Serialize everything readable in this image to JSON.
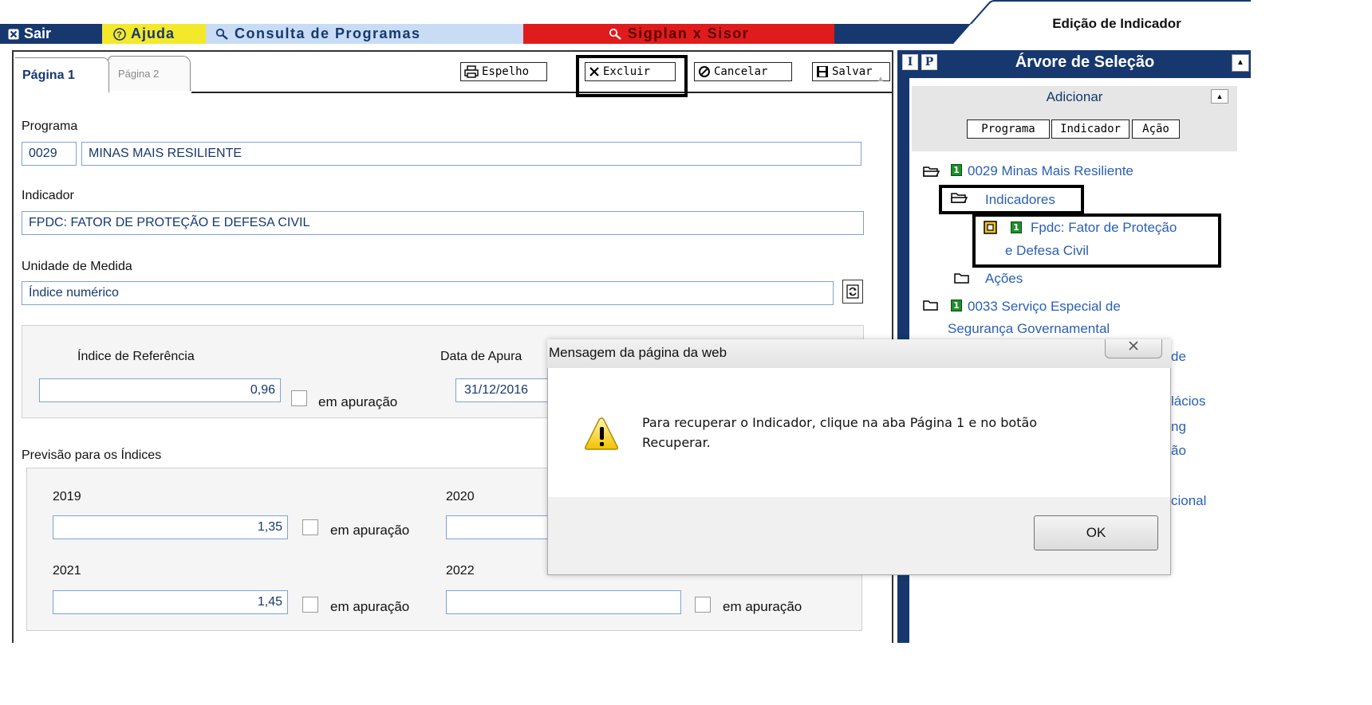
{
  "menu": {
    "sair": "Sair",
    "ajuda": "Ajuda",
    "consulta": "Consulta de Programas",
    "sigplan": "Sigplan x Sisor"
  },
  "page_title": "Edição de Indicador",
  "tabs": {
    "pagina1": "Página 1",
    "pagina2": "Página 2"
  },
  "toolbar": {
    "espelho": "Espelho",
    "excluir": "Excluir",
    "cancelar": "Cancelar",
    "salvar": "Salvar"
  },
  "form": {
    "programa_label": "Programa",
    "programa_codigo": "0029",
    "programa_nome": "MINAS MAIS RESILIENTE",
    "indicador_label": "Indicador",
    "indicador_value": "FPDC: FATOR DE PROTEÇÃO E DEFESA CIVIL",
    "unidade_label": "Unidade de Medida",
    "unidade_value": "Índice numérico",
    "indice_ref_label": "Índice de Referência",
    "indice_ref_value": "0,96",
    "data_apuracao_label": "Data de Apura",
    "data_apuracao_value": "31/12/2016",
    "em_apuracao": "em apuração",
    "previsao_label": "Previsão para os Índices",
    "years": [
      {
        "year": "2019",
        "value": "1,35"
      },
      {
        "year": "2020",
        "value": ""
      },
      {
        "year": "2021",
        "value": "1,45"
      },
      {
        "year": "2022",
        "value": ""
      }
    ]
  },
  "tree": {
    "header_i": "I",
    "header_p": "P",
    "title": "Árvore de Seleção",
    "adicionar": "Adicionar",
    "add_programa": "Programa",
    "add_indicador": "Indicador",
    "add_acao": "Ação",
    "badge": "1",
    "items": [
      "0029 Minas Mais Resiliente",
      "Indicadores",
      "Fpdc: Fator de Proteção",
      "e Defesa Civil",
      "Ações",
      "0033 Serviço Especial de",
      "Segurança Governamental"
    ],
    "partial_items": [
      "de",
      "lácios",
      "ng",
      "ão",
      "cional"
    ]
  },
  "dialog": {
    "title": "Mensagem da página da web",
    "message_line1": "Para recuperar o Indicador, clique na aba Página 1 e no botão",
    "message_line2": "Recuperar.",
    "ok": "OK"
  }
}
